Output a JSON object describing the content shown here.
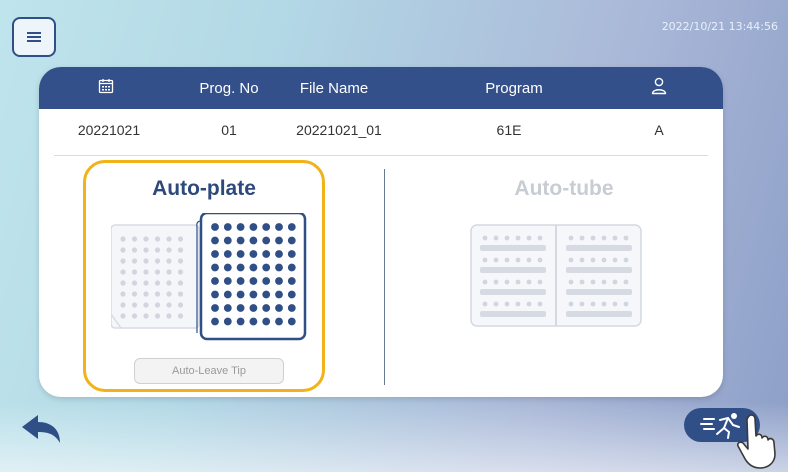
{
  "header": {
    "datetime": "2022/10/21 13:44:56"
  },
  "table": {
    "columns": [
      {
        "icon": "calendar-icon",
        "label": ""
      },
      {
        "label": "Prog. No"
      },
      {
        "label": "File Name"
      },
      {
        "label": "Program"
      },
      {
        "icon": "user-icon",
        "label": ""
      }
    ],
    "row": {
      "date": "20221021",
      "prog_no": "01",
      "file_name": "20221021_01",
      "program": "61E",
      "user": "A"
    }
  },
  "modes": {
    "auto_plate": {
      "label": "Auto-plate",
      "selected": true
    },
    "auto_tube": {
      "label": "Auto-tube",
      "selected": false
    },
    "auto_leave_tip": {
      "label": "Auto-Leave Tip"
    }
  },
  "colors": {
    "primary": "#34508a",
    "selected_border": "#f2b21a",
    "disabled_text": "#c8ccd3"
  }
}
